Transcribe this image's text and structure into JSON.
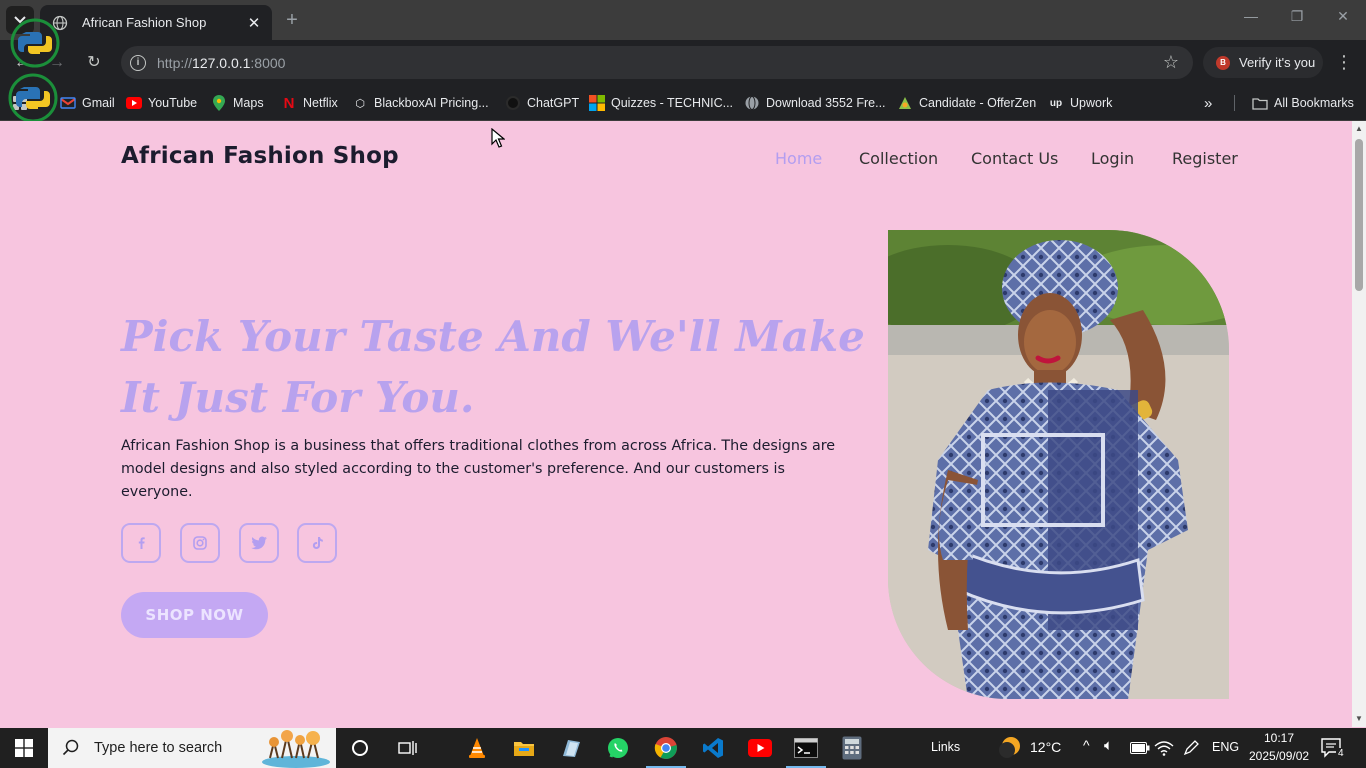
{
  "browser": {
    "tab_title": "African Fashion Shop",
    "url_prefix": "http://",
    "url_host": "127.0.0.1",
    "url_port": ":8000",
    "verify_label": "Verify it's you",
    "verify_avatar": "B",
    "all_bookmarks": "All Bookmarks",
    "bookmarks": [
      {
        "label": "Gmail",
        "icon": "gmail-icon"
      },
      {
        "label": "YouTube",
        "icon": "youtube-icon"
      },
      {
        "label": "Maps",
        "icon": "maps-icon"
      },
      {
        "label": "Netflix",
        "icon": "netflix-icon"
      },
      {
        "label": "BlackboxAI Pricing...",
        "icon": "blackbox-icon"
      },
      {
        "label": "ChatGPT",
        "icon": "chatgpt-icon"
      },
      {
        "label": "Quizzes - TECHNIC...",
        "icon": "microsoft-icon"
      },
      {
        "label": "Download 3552 Fre...",
        "icon": "globe-icon"
      },
      {
        "label": "Candidate - OfferZen",
        "icon": "offerzen-icon"
      },
      {
        "label": "Upwork",
        "icon": "upwork-icon"
      }
    ]
  },
  "site": {
    "logo": "African Fashion Shop",
    "nav": [
      {
        "label": "Home",
        "active": true
      },
      {
        "label": "Collection",
        "active": false
      },
      {
        "label": "Contact Us",
        "active": false
      },
      {
        "label": "Login",
        "active": false
      },
      {
        "label": "Register",
        "active": false
      }
    ],
    "hero_title": "Pick Your Taste And We'll Make It Just For You.",
    "hero_text": "African Fashion Shop is a business that offers traditional clothes from across Africa. The designs are model designs and also styled according to the customer's preference. And our customers is everyone.",
    "social": [
      "facebook-icon",
      "instagram-icon",
      "twitter-icon",
      "tiktok-icon"
    ],
    "cta": "SHOP NOW",
    "colors": {
      "background": "#f7c5df",
      "accent": "#b8a2ee",
      "button": "#c4a8f3"
    }
  },
  "taskbar": {
    "search_placeholder": "Type here to search",
    "links_label": "Links",
    "weather": "12°C",
    "language": "ENG",
    "time": "10:17",
    "date": "2025/09/02",
    "notifications": "4"
  }
}
